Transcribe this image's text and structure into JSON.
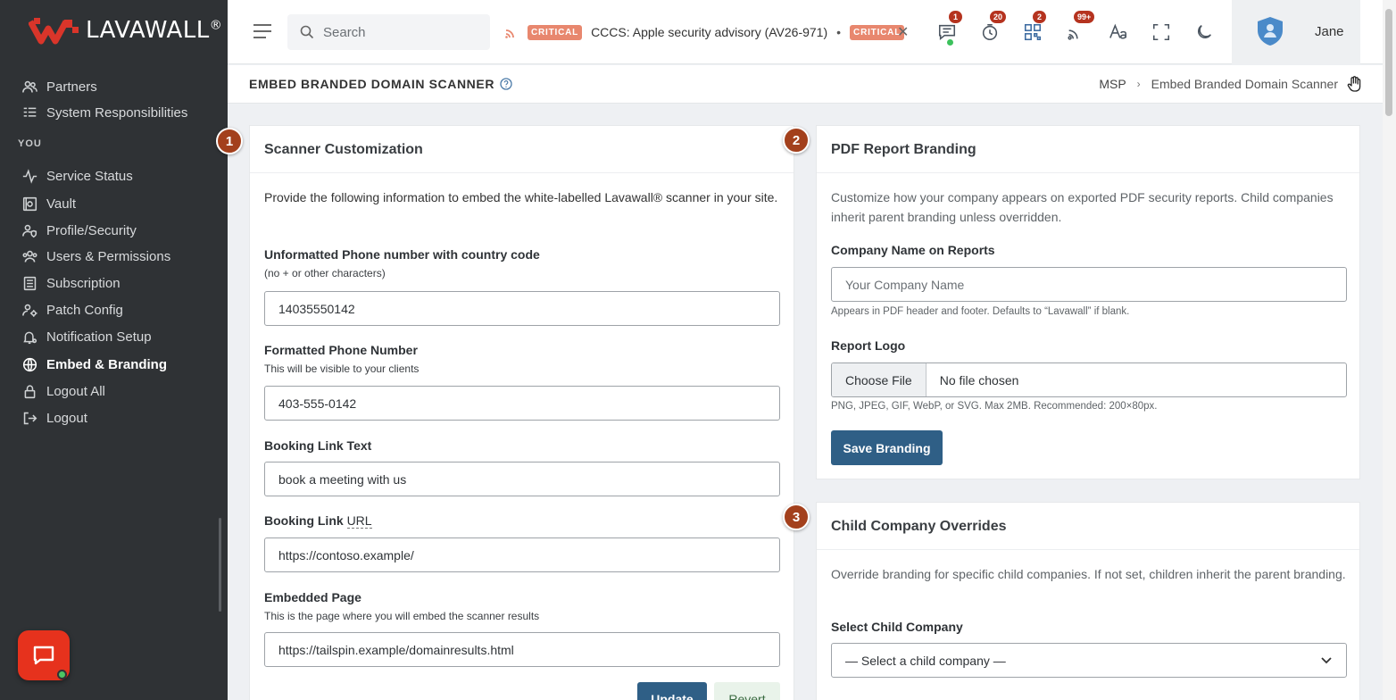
{
  "brand": {
    "name": "LAVAWALL",
    "reg": "®"
  },
  "sidebar": {
    "section_you": "YOU",
    "items": [
      {
        "label": "Partners",
        "icon": "partners-icon"
      },
      {
        "label": "System Responsibilities",
        "icon": "list-icon"
      },
      {
        "label": "Service Status",
        "icon": "pulse-icon"
      },
      {
        "label": "Vault",
        "icon": "vault-icon"
      },
      {
        "label": "Profile/Security",
        "icon": "user-shield-icon"
      },
      {
        "label": "Users & Permissions",
        "icon": "users-icon"
      },
      {
        "label": "Subscription",
        "icon": "subscription-icon"
      },
      {
        "label": "Patch Config",
        "icon": "user-gear-icon"
      },
      {
        "label": "Notification Setup",
        "icon": "bell-gear-icon"
      },
      {
        "label": "Embed & Branding",
        "icon": "globe-icon",
        "active": true
      },
      {
        "label": "Logout All",
        "icon": "lock-icon"
      },
      {
        "label": "Logout",
        "icon": "logout-icon"
      }
    ]
  },
  "header": {
    "search_placeholder": "Search",
    "ticker": {
      "badge": "CRITICAL",
      "text": "CCCS: Apple security advisory (AV26-971)",
      "badge2": "CRITICAL"
    },
    "badges": {
      "messages": "1",
      "timer": "20",
      "qr": "2",
      "feeds": "99+"
    },
    "user": "Jane"
  },
  "page": {
    "title": "EMBED BRANDED DOMAIN SCANNER",
    "breadcrumb": [
      "MSP",
      "Embed Branded Domain Scanner"
    ]
  },
  "scanner": {
    "step": "1",
    "title": "Scanner Customization",
    "desc": "Provide the following information to embed the white-labelled Lavawall® scanner in your site.",
    "phone_label": "Unformatted Phone number with country code",
    "phone_hint": "(no + or other characters)",
    "phone_value": "14035550142",
    "fphone_label": "Formatted Phone Number",
    "fphone_hint": "This will be visible to your clients",
    "fphone_value": "403-555-0142",
    "booking_text_label": "Booking Link Text",
    "booking_text_value": "book a meeting with us",
    "booking_url_label": "Booking Link ",
    "booking_url_abbr": "URL",
    "booking_url_value": "https://contoso.example/",
    "embedded_label": "Embedded Page",
    "embedded_hint": "This is the page where you will embed the scanner results",
    "embedded_value": "https://tailspin.example/domainresults.html",
    "update_btn": "Update",
    "revert_btn": "Revert"
  },
  "pdf": {
    "step": "2",
    "title": "PDF Report Branding",
    "desc": "Customize how your company appears on exported PDF security reports. Child companies inherit parent branding unless overridden.",
    "company_label": "Company Name on Reports",
    "company_placeholder": "Your Company Name",
    "company_hint": "Appears in PDF header and footer. Defaults to “Lavawall” if blank.",
    "logo_label": "Report Logo",
    "choose_file": "Choose File",
    "no_file": "No file chosen",
    "logo_hint": "PNG, JPEG, GIF, WebP, or SVG. Max 2MB. Recommended: 200×80px.",
    "save_btn": "Save Branding"
  },
  "child": {
    "step": "3",
    "title": "Child Company Overrides",
    "desc": "Override branding for specific child companies. If not set, children inherit the parent branding.",
    "select_label": "Select Child Company",
    "select_value": "— Select a child company —"
  },
  "colors": {
    "accent": "#2f5f86",
    "step": "#a3401c",
    "critical": "#e8876e",
    "sidebar": "#2f3235",
    "brand_red": "#e6321d"
  }
}
